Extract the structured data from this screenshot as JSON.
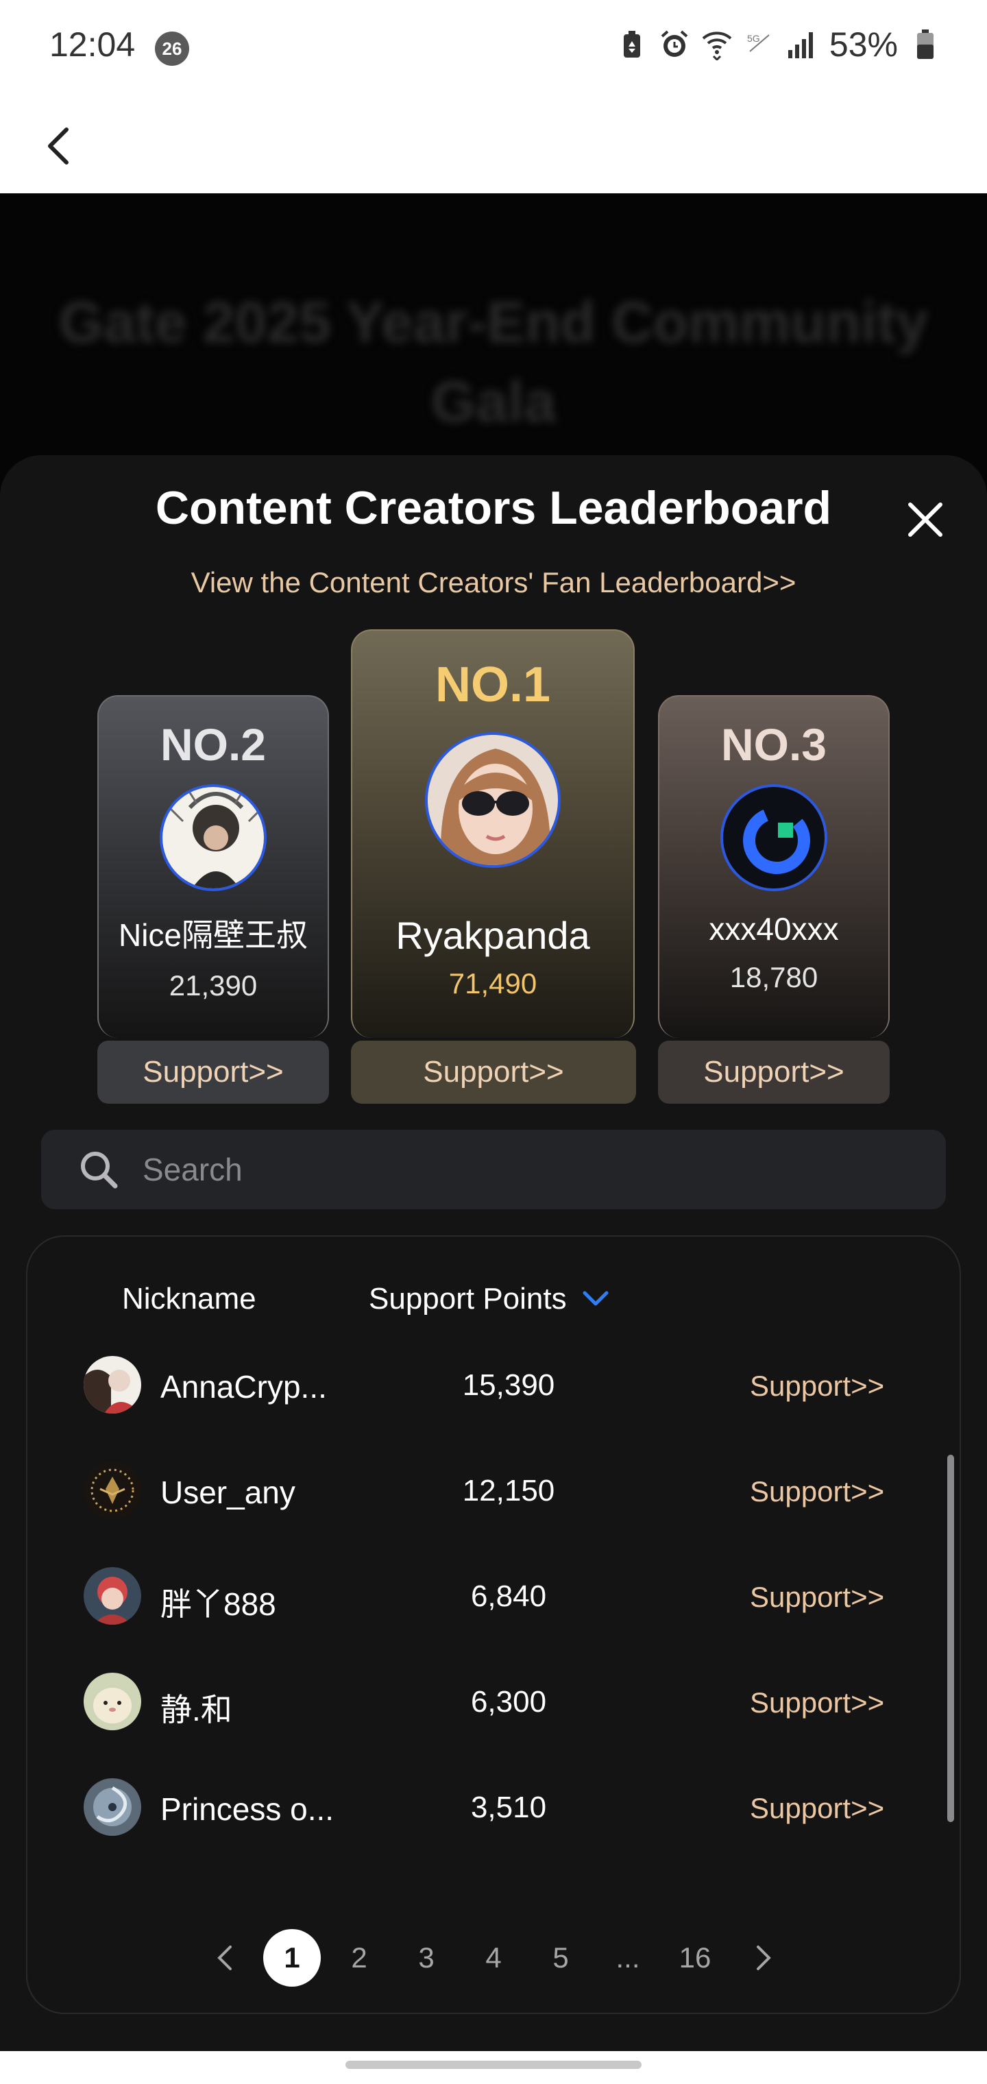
{
  "status_bar": {
    "time": "12:04",
    "notification_count": "26",
    "battery": "53%",
    "icons": [
      "battery-saver-icon",
      "alarm-icon",
      "wifi-icon",
      "volte-icon",
      "signal-icon",
      "battery-icon"
    ]
  },
  "header": {
    "back_icon": "chevron-left-icon"
  },
  "background_page": {
    "title": "Gate 2025 Year-End Community Gala"
  },
  "sheet": {
    "title": "Content Creators Leaderboard",
    "fan_link": "View the Content Creators' Fan Leaderboard>>",
    "close_icon": "close-icon"
  },
  "podium": [
    {
      "rank": "NO.2",
      "name": "Nice隔壁王叔",
      "points": "21,390",
      "support": "Support>>"
    },
    {
      "rank": "NO.1",
      "name": "Ryakpanda",
      "points": "71,490",
      "support": "Support>>"
    },
    {
      "rank": "NO.3",
      "name": "xxx40xxx",
      "points": "18,780",
      "support": "Support>>"
    }
  ],
  "search": {
    "placeholder": "Search"
  },
  "table": {
    "headers": {
      "nickname": "Nickname",
      "points": "Support Points"
    },
    "rows": [
      {
        "name": "AnnaCryp...",
        "points": "15,390",
        "support": "Support>>"
      },
      {
        "name": "User_any",
        "points": "12,150",
        "support": "Support>>"
      },
      {
        "name": "胖丫888",
        "points": "6,840",
        "support": "Support>>"
      },
      {
        "name": "静.和",
        "points": "6,300",
        "support": "Support>>"
      },
      {
        "name": "Princess o...",
        "points": "3,510",
        "support": "Support>>"
      }
    ]
  },
  "pagination": {
    "pages": [
      "1",
      "2",
      "3",
      "4",
      "5",
      "...",
      "16"
    ],
    "current": "1"
  },
  "colors": {
    "accent_gold": "#f2c46b",
    "support_text": "#ecc7a2",
    "ring_blue": "#2b59e0",
    "sort_arrow": "#2f7ef5"
  }
}
